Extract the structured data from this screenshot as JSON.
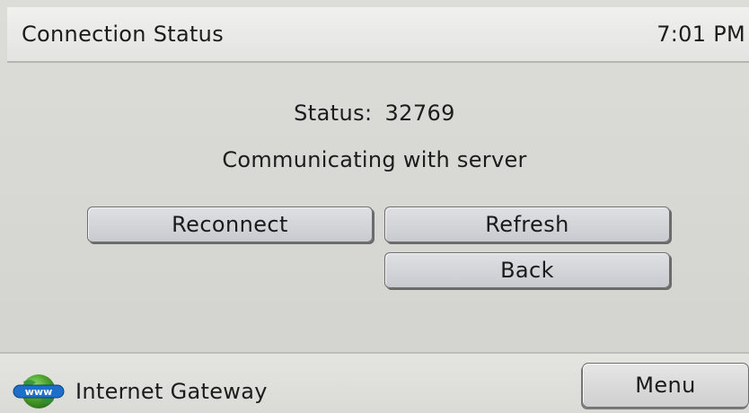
{
  "header": {
    "title": "Connection Status",
    "time": "7:01 PM"
  },
  "status": {
    "label": "Status:",
    "code": "32769",
    "message": "Communicating with server"
  },
  "actions": {
    "reconnect_label": "Reconnect",
    "refresh_label": "Refresh",
    "back_label": "Back"
  },
  "footer": {
    "icon": "globe-www-icon",
    "gateway_label": "Internet Gateway",
    "menu_label": "Menu"
  },
  "colors": {
    "background": "#d6d6d2",
    "header_background": "#e8e8e5",
    "button_face": "#d2d3d7",
    "text": "#1c1c1c",
    "globe_green": "#4aa02c",
    "globe_blue": "#1d6fc9"
  }
}
